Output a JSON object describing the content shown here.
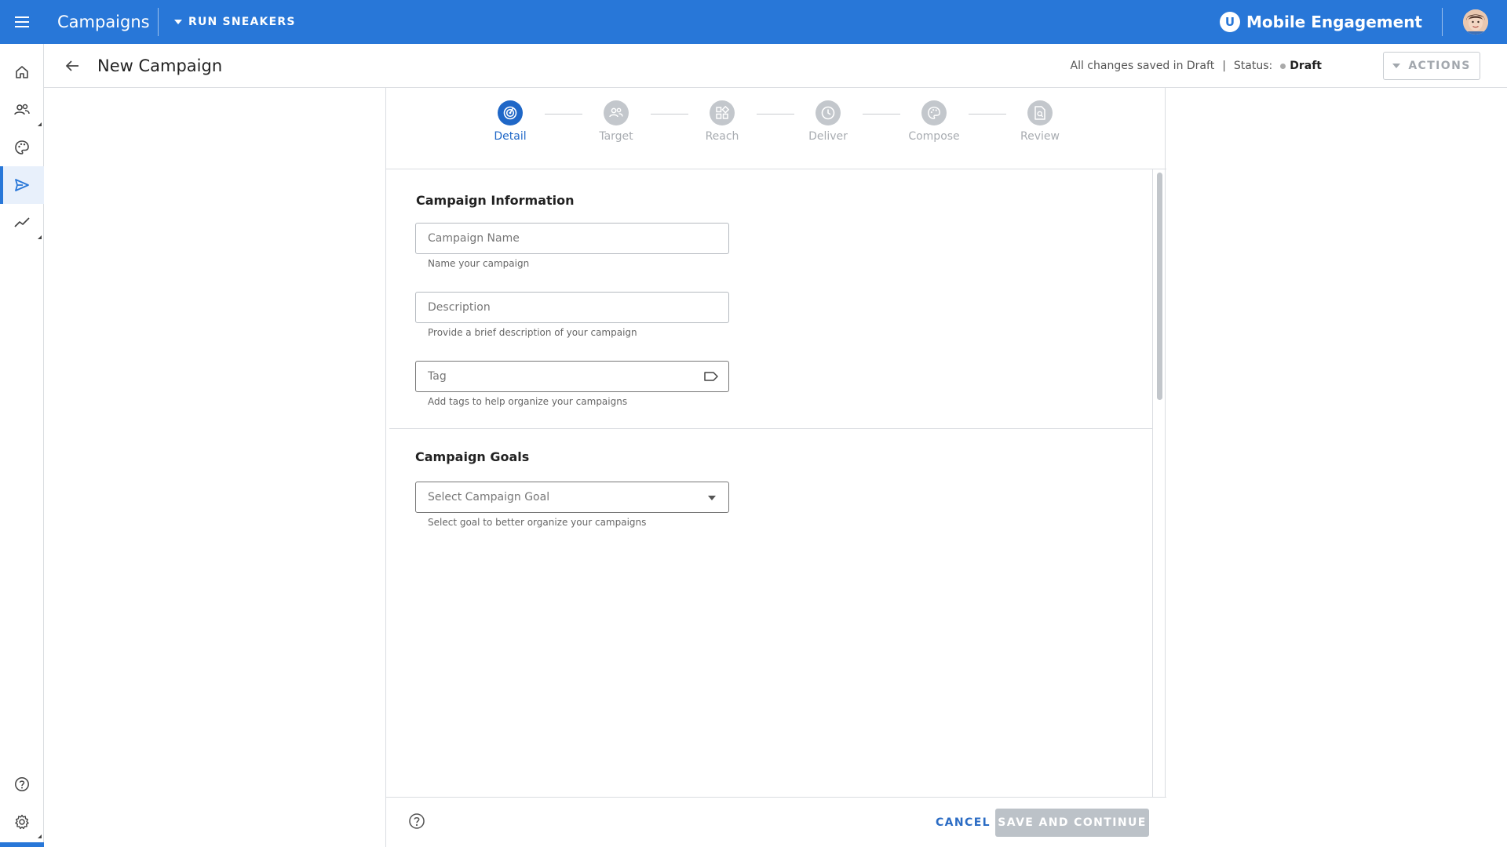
{
  "topbar": {
    "app_title": "Campaigns",
    "org_name": "RUN SNEAKERS",
    "brand_logo_letter": "U",
    "brand_name": "Mobile Engagement"
  },
  "leftnav": {
    "items": [
      {
        "name": "home",
        "icon": "home-icon"
      },
      {
        "name": "audiences",
        "icon": "people-icon"
      },
      {
        "name": "themes",
        "icon": "palette-icon"
      },
      {
        "name": "campaigns",
        "icon": "send-icon",
        "active": true
      },
      {
        "name": "analytics",
        "icon": "trend-icon"
      }
    ],
    "bottom": [
      {
        "name": "help",
        "icon": "help-circle-icon"
      },
      {
        "name": "settings",
        "icon": "gear-icon"
      }
    ]
  },
  "subheader": {
    "title": "New Campaign",
    "save_state": "All changes saved in Draft",
    "separator": "|",
    "status_label": "Status:",
    "status_value": "Draft",
    "actions_label": "ACTIONS"
  },
  "stepper": {
    "steps": [
      {
        "label": "Detail",
        "active": true
      },
      {
        "label": "Target"
      },
      {
        "label": "Reach"
      },
      {
        "label": "Deliver"
      },
      {
        "label": "Compose"
      },
      {
        "label": "Review"
      }
    ]
  },
  "campaign_info": {
    "title": "Campaign Information",
    "name_placeholder": "Campaign Name",
    "name_helper": "Name your campaign",
    "description_placeholder": "Description",
    "description_helper": "Provide a brief description of your campaign",
    "tag_placeholder": "Tag",
    "tag_helper": "Add tags to help organize your campaigns"
  },
  "campaign_goals": {
    "title": "Campaign Goals",
    "goal_placeholder": "Select Campaign Goal",
    "goal_helper": "Select goal to better organize your campaigns"
  },
  "footer": {
    "cancel_label": "CANCEL",
    "save_label": "SAVE AND CONTINUE"
  },
  "colors": {
    "primary": "#2877d8",
    "step_active": "#1f67c7",
    "step_inactive": "#c3c7cc",
    "disabled_button": "#bcc2c8"
  }
}
